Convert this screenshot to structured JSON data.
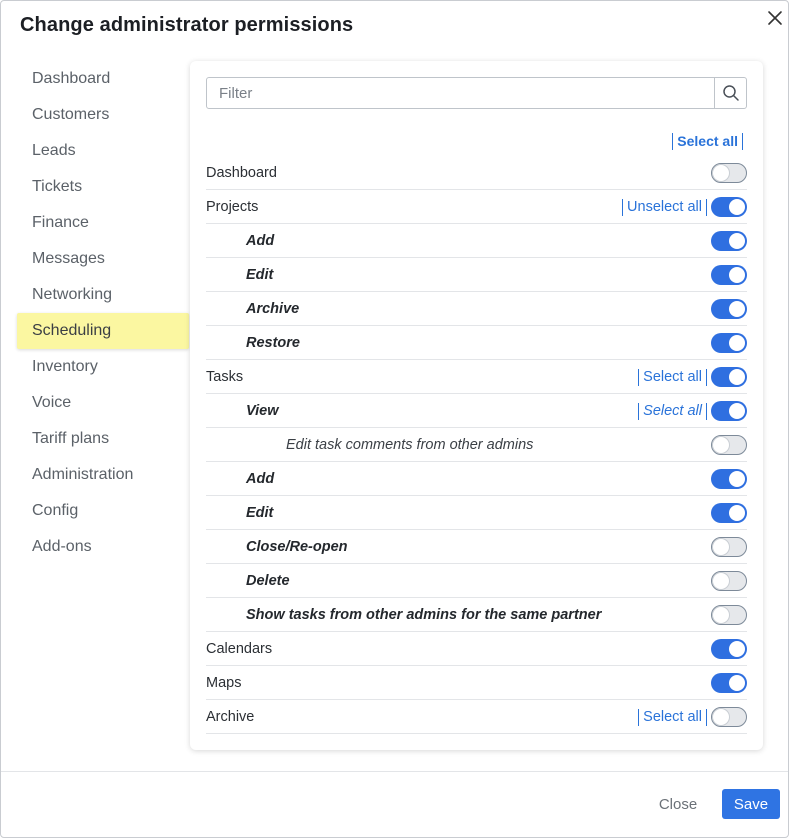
{
  "dialog": {
    "title": "Change administrator permissions",
    "close_icon": "close-icon"
  },
  "sidebar": {
    "items": [
      {
        "label": "Dashboard",
        "active": false
      },
      {
        "label": "Customers",
        "active": false
      },
      {
        "label": "Leads",
        "active": false
      },
      {
        "label": "Tickets",
        "active": false
      },
      {
        "label": "Finance",
        "active": false
      },
      {
        "label": "Messages",
        "active": false
      },
      {
        "label": "Networking",
        "active": false
      },
      {
        "label": "Scheduling",
        "active": true
      },
      {
        "label": "Inventory",
        "active": false
      },
      {
        "label": "Voice",
        "active": false
      },
      {
        "label": "Tariff plans",
        "active": false
      },
      {
        "label": "Administration",
        "active": false
      },
      {
        "label": "Config",
        "active": false
      },
      {
        "label": "Add-ons",
        "active": false
      }
    ]
  },
  "filter": {
    "placeholder": "Filter",
    "value": "",
    "icon": "search-icon"
  },
  "top_select_all": "Select all",
  "permissions": [
    {
      "label": "Dashboard",
      "level": 0,
      "on": false,
      "link": ""
    },
    {
      "label": "Projects",
      "level": 0,
      "on": true,
      "link": "Unselect all"
    },
    {
      "label": "Add",
      "level": 1,
      "on": true,
      "link": ""
    },
    {
      "label": "Edit",
      "level": 1,
      "on": true,
      "link": ""
    },
    {
      "label": "Archive",
      "level": 1,
      "on": true,
      "link": ""
    },
    {
      "label": "Restore",
      "level": 1,
      "on": true,
      "link": ""
    },
    {
      "label": "Tasks",
      "level": 0,
      "on": true,
      "link": "Select all"
    },
    {
      "label": "View",
      "level": 1,
      "on": true,
      "link": "Select all"
    },
    {
      "label": "Edit task comments from other admins",
      "level": 2,
      "on": false,
      "link": ""
    },
    {
      "label": "Add",
      "level": 1,
      "on": true,
      "link": ""
    },
    {
      "label": "Edit",
      "level": 1,
      "on": true,
      "link": ""
    },
    {
      "label": "Close/Re-open",
      "level": 1,
      "on": false,
      "link": ""
    },
    {
      "label": "Delete",
      "level": 1,
      "on": false,
      "link": ""
    },
    {
      "label": "Show tasks from other admins for the same partner",
      "level": 1,
      "on": false,
      "link": ""
    },
    {
      "label": "Calendars",
      "level": 0,
      "on": true,
      "link": ""
    },
    {
      "label": "Maps",
      "level": 0,
      "on": true,
      "link": ""
    },
    {
      "label": "Archive",
      "level": 0,
      "on": false,
      "link": "Select all"
    }
  ],
  "footer": {
    "close_label": "Close",
    "save_label": "Save"
  },
  "colors": {
    "accent": "#2f74e3",
    "active_nav": "#fbf7a1",
    "link": "#2a73d9"
  }
}
